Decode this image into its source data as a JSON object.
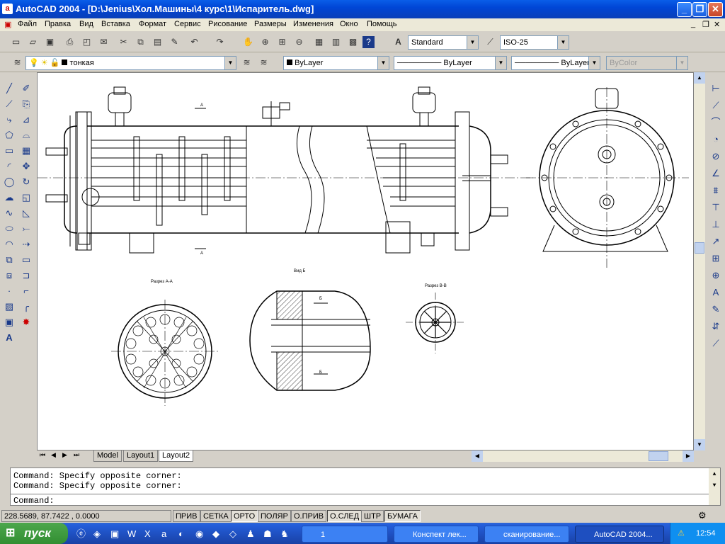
{
  "window": {
    "title": "AutoCAD 2004 - [D:\\Jenius\\Хол.Машины\\4 курс\\1\\Испаритель.dwg]",
    "app_icon": "a"
  },
  "menubar": [
    "Файл",
    "Правка",
    "Вид",
    "Вставка",
    "Формат",
    "Сервис",
    "Рисование",
    "Размеры",
    "Изменения",
    "Окно",
    "Помощь"
  ],
  "toolbar": {
    "text_style": "Standard",
    "dim_style": "ISO-25"
  },
  "layers": {
    "current_layer": "тонкая",
    "color": "ByLayer",
    "linetype": "ByLayer",
    "lineweight": "ByLayer",
    "plotstyle": "ByColor"
  },
  "drawing": {
    "section_a_label": "Разрез А-А",
    "view_b_label": "Вид Б",
    "section_v_label": "Разрез В-В",
    "mark_a": "А",
    "mark_b": "Б"
  },
  "layout_tabs": [
    "Model",
    "Layout1",
    "Layout2"
  ],
  "active_tab": "Layout2",
  "cmdline": {
    "lines": [
      "Command: Specify opposite corner:",
      "Command: Specify opposite corner:"
    ],
    "prompt": "Command:"
  },
  "status": {
    "coords": "228.5689, 87.7422 , 0.0000",
    "buttons": [
      "ПРИВ",
      "СЕТКА",
      "ОРТО",
      "ПОЛЯР",
      "О.ПРИВ",
      "О.СЛЕД",
      "ШТР",
      "БУМАГА"
    ],
    "on_buttons": [
      "ОРТО",
      "О.СЛЕД",
      "БУМАГА"
    ]
  },
  "taskbar": {
    "start": "пуск",
    "tasks": [
      "1",
      "Конспект лек...",
      "сканирование...",
      "AutoCAD 2004..."
    ],
    "active_task": "AutoCAD 2004...",
    "clock": "12:54"
  }
}
